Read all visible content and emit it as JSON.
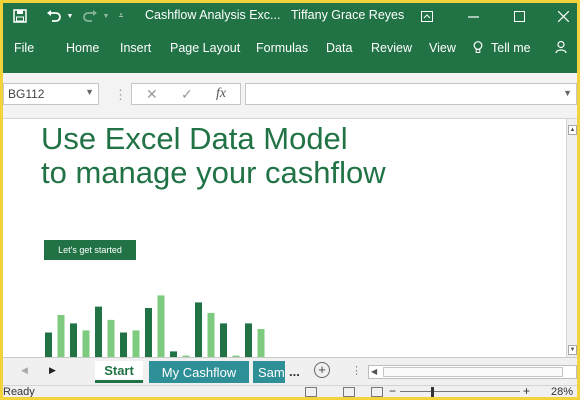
{
  "window": {
    "title": "Cashflow Analysis Exc...",
    "user": "Tiffany Grace Reyes"
  },
  "ribbon": {
    "tabs": [
      "File",
      "Home",
      "Insert",
      "Page Layout",
      "Formulas",
      "Data",
      "Review",
      "View",
      "Tell me"
    ]
  },
  "formula_bar": {
    "name_box": "BG112",
    "fx_label": "fx",
    "formula_value": ""
  },
  "sheet": {
    "headline_line1": "Use Excel Data Model",
    "headline_line2": "to manage your cashflow",
    "cta_label": "Let's get started",
    "bar_colors": {
      "dark": "#217346",
      "light": "#7ccb7f"
    },
    "bar_levels": [
      0.35,
      0.6,
      0.48,
      0.38,
      0.72,
      0.53,
      0.35,
      0.38,
      0.7,
      0.88,
      0.08,
      0.02,
      0.78,
      0.63,
      0.48,
      0.02,
      0.48,
      0.4
    ]
  },
  "sheet_tabs": {
    "tabs": [
      "Start",
      "My Cashflow",
      "Sam"
    ],
    "active": "Start",
    "more": "..."
  },
  "status": {
    "text": "Ready",
    "zoom": "28%"
  },
  "colors": {
    "accent": "#217346",
    "tab_teal": "#2e8f96",
    "frame": "#f3d23a"
  }
}
